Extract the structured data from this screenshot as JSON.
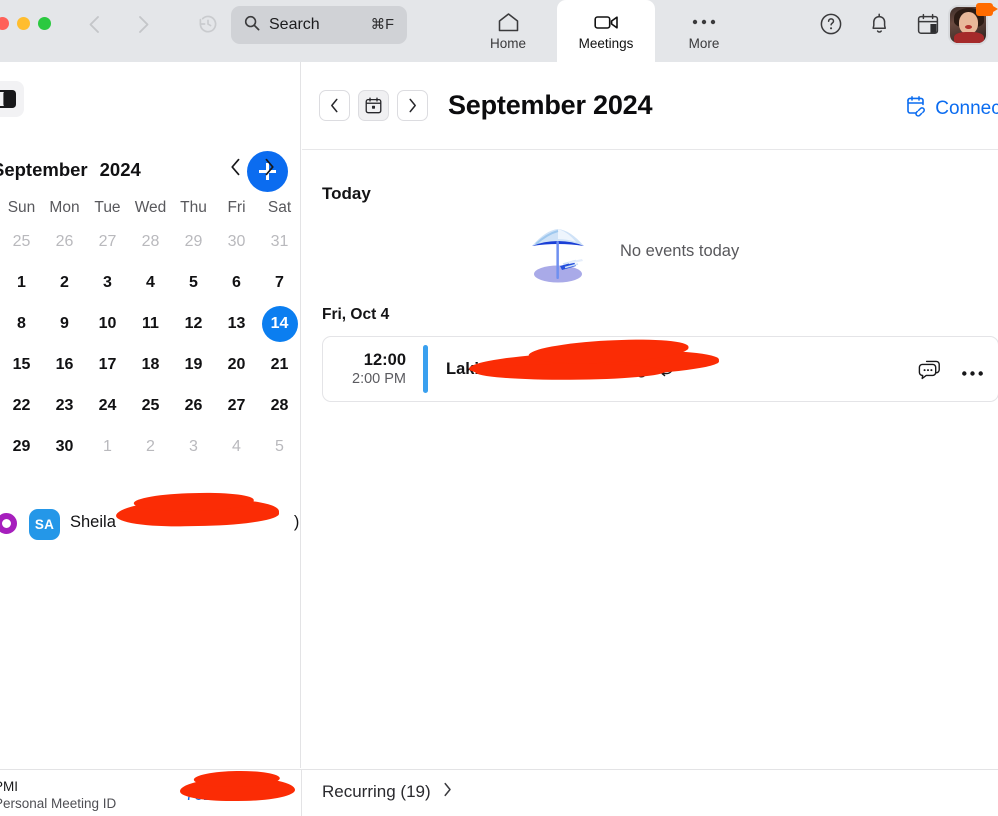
{
  "titlebar": {
    "search": {
      "label": "Search",
      "shortcut": "⌘F",
      "icon": "search-icon"
    },
    "nav": {
      "back_icon": "chevron-left-icon",
      "forward_icon": "chevron-right-icon",
      "history_icon": "history-clock-icon"
    },
    "tabs": [
      {
        "label": "Home",
        "icon": "home-icon",
        "active": false
      },
      {
        "label": "Meetings",
        "icon": "video-camera-icon",
        "active": true
      },
      {
        "label": "More",
        "icon": "ellipsis-icon",
        "active": false
      }
    ],
    "icons": [
      {
        "name": "help-icon",
        "glyph": "?"
      },
      {
        "name": "bell-icon",
        "glyph": "bell"
      },
      {
        "name": "calendar-icon",
        "glyph": "calendar"
      }
    ],
    "avatar": {
      "name": "user-avatar",
      "status": "in-meeting"
    },
    "traffic_lights": [
      "close",
      "minimize",
      "zoom"
    ]
  },
  "sidebar": {
    "toggle_icon": "toggle-sidebar-icon",
    "add_button_label": "+",
    "calendar": {
      "month": "September",
      "year": "2024",
      "prev_icon": "chevron-left-icon",
      "next_icon": "chevron-right-icon",
      "day_headers": [
        "Sun",
        "Mon",
        "Tue",
        "Wed",
        "Thu",
        "Fri",
        "Sat"
      ],
      "weeks": [
        [
          {
            "d": "25",
            "muted": true
          },
          {
            "d": "26",
            "muted": true
          },
          {
            "d": "27",
            "muted": true
          },
          {
            "d": "28",
            "muted": true
          },
          {
            "d": "29",
            "muted": true
          },
          {
            "d": "30",
            "muted": true
          },
          {
            "d": "31",
            "muted": true
          }
        ],
        [
          {
            "d": "1"
          },
          {
            "d": "2"
          },
          {
            "d": "3"
          },
          {
            "d": "4"
          },
          {
            "d": "5"
          },
          {
            "d": "6"
          },
          {
            "d": "7"
          }
        ],
        [
          {
            "d": "8"
          },
          {
            "d": "9"
          },
          {
            "d": "10"
          },
          {
            "d": "11"
          },
          {
            "d": "12"
          },
          {
            "d": "13"
          },
          {
            "d": "14",
            "today": true
          }
        ],
        [
          {
            "d": "15"
          },
          {
            "d": "16"
          },
          {
            "d": "17"
          },
          {
            "d": "18"
          },
          {
            "d": "19"
          },
          {
            "d": "20"
          },
          {
            "d": "21"
          }
        ],
        [
          {
            "d": "22"
          },
          {
            "d": "23"
          },
          {
            "d": "24"
          },
          {
            "d": "25"
          },
          {
            "d": "26"
          },
          {
            "d": "27"
          },
          {
            "d": "28"
          }
        ],
        [
          {
            "d": "29"
          },
          {
            "d": "30"
          },
          {
            "d": "1",
            "muted": true
          },
          {
            "d": "2",
            "muted": true
          },
          {
            "d": "3",
            "muted": true
          },
          {
            "d": "4",
            "muted": true
          },
          {
            "d": "5",
            "muted": true
          }
        ]
      ],
      "today_highlight_color": "#0b7ef0"
    },
    "user_row": {
      "ring_icon": "calendar-status-ring-icon",
      "ring_color": "#a61fbd",
      "avatar_initials": "SA",
      "avatar_color": "#2497e8",
      "name": "Sheila",
      "name_suffix": ")",
      "redacted": true
    }
  },
  "main": {
    "header": {
      "prev_icon": "chevron-left-icon",
      "calendar_icon": "calendar-icon",
      "next_icon": "chevron-right-icon",
      "title": "September 2024",
      "connect_label": "Connect",
      "connect_icon": "calendar-link-icon",
      "connect_color": "#0b6cf0"
    },
    "today_section": {
      "label": "Today",
      "empty_text": "No events today",
      "empty_illustration": "beach-umbrella-illustration"
    },
    "day_groups": [
      {
        "label": "Fri, Oct 4",
        "meetings": [
          {
            "start_time": "12:00",
            "end_time": "2:00 PM",
            "title": "Lakin Consulting Meeting",
            "title_redacted": true,
            "accent_color": "#3aa0ef",
            "recurring_icon": "recurring-icon",
            "chat_icon": "chat-bubbles-icon",
            "more_icon": "ellipsis-icon"
          }
        ]
      }
    ]
  },
  "bottombar": {
    "pmi_title": "PMI",
    "pmi_subtitle": "Personal Meeting ID",
    "pmi_number": "761 ... 90",
    "pmi_redacted": true,
    "recurring_label": "Recurring (19)",
    "recurring_chevron": "chevron-right-icon"
  }
}
